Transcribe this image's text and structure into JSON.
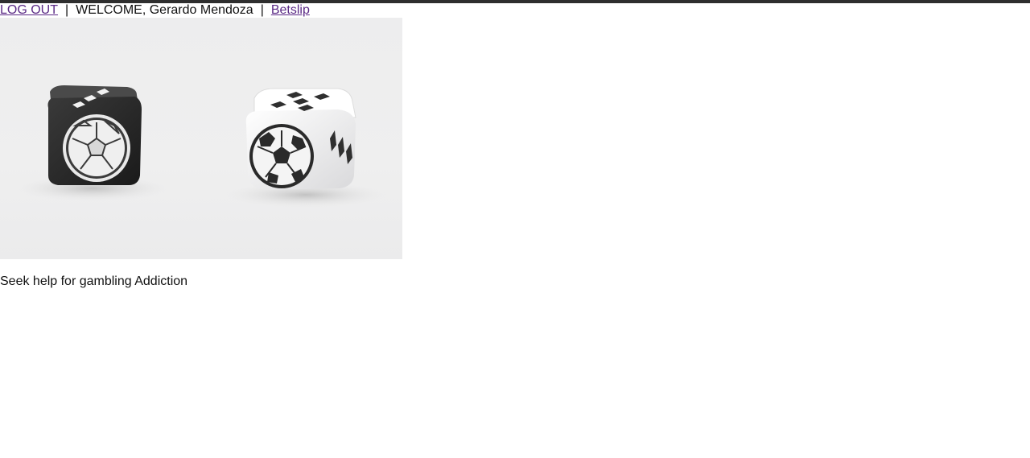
{
  "header": {
    "logout_label": "LOG OUT",
    "separator": "|",
    "welcome_text": "WELCOME, Gerardo Mendoza",
    "betslip_label": "Betslip"
  },
  "hero": {
    "image_alt": "Two soccer dice",
    "icon": "soccer-dice-image"
  },
  "footer": {
    "help_text": "Seek help for gambling Addiction"
  },
  "colors": {
    "link": "#5b2a86",
    "top_rule": "#2e2e2e",
    "image_bg": "#ededee"
  }
}
